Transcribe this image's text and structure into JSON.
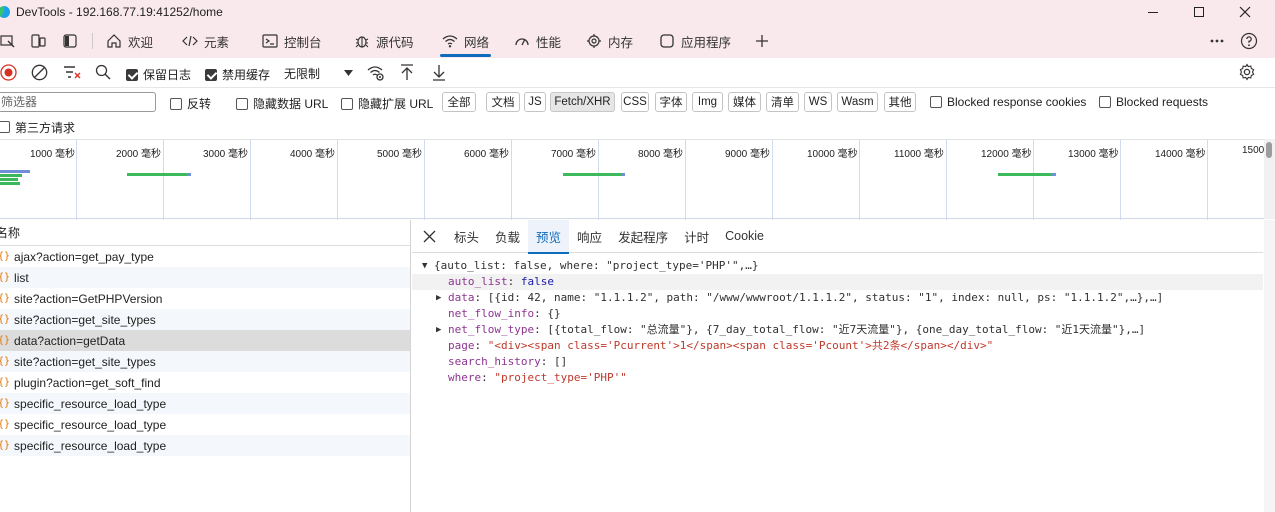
{
  "window": {
    "title": "DevTools - 192.168.77.19:41252/home",
    "controls": [
      "minimize",
      "maximize",
      "close"
    ]
  },
  "tabs": [
    {
      "label": "欢迎",
      "icon": "home-icon"
    },
    {
      "label": "元素",
      "icon": "code-icon"
    },
    {
      "label": "控制台",
      "icon": "console-icon"
    },
    {
      "label": "源代码",
      "icon": "bug-icon"
    },
    {
      "label": "网络",
      "icon": "wifi-icon",
      "active": true
    },
    {
      "label": "性能",
      "icon": "performance-icon"
    },
    {
      "label": "内存",
      "icon": "memory-icon"
    },
    {
      "label": "应用程序",
      "icon": "application-icon"
    }
  ],
  "toolbar": {
    "preserve_log": "保留日志",
    "disable_cache": "禁用缓存",
    "throttle": "无限制"
  },
  "filter": {
    "placeholder": "筛选器",
    "invert": "反转",
    "hide_data_url": "隐藏数据 URL",
    "hide_ext_url": "隐藏扩展 URL",
    "types": [
      "全部",
      "文档",
      "JS",
      "Fetch/XHR",
      "CSS",
      "字体",
      "Img",
      "媒体",
      "清单",
      "WS",
      "Wasm",
      "其他"
    ],
    "active_type": "Fetch/XHR",
    "blocked_cookies": "Blocked response cookies",
    "blocked_requests": "Blocked requests",
    "third_party": "第三方请求"
  },
  "overview": {
    "ticks": [
      "1000 毫秒",
      "2000 毫秒",
      "3000 毫秒",
      "4000 毫秒",
      "5000 毫秒",
      "6000 毫秒",
      "7000 毫秒",
      "8000 毫秒",
      "9000 毫秒",
      "10000 毫秒",
      "11000 毫秒",
      "12000 毫秒",
      "13000 毫秒",
      "14000 毫秒",
      "1500"
    ]
  },
  "requests": {
    "header": "名称",
    "items": [
      "ajax?action=get_pay_type",
      "list",
      "site?action=GetPHPVersion",
      "site?action=get_site_types",
      "data?action=getData",
      "site?action=get_site_types",
      "plugin?action=get_soft_find",
      "specific_resource_load_type",
      "specific_resource_load_type",
      "specific_resource_load_type"
    ],
    "selected_index": 4
  },
  "detail": {
    "tabs": [
      "标头",
      "负载",
      "预览",
      "响应",
      "发起程序",
      "计时",
      "Cookie"
    ],
    "active_tab": "预览",
    "preview": {
      "root": "{auto_list: false, where: \"project_type='PHP'\",…}",
      "auto_list_key": "auto_list",
      "auto_list_val": "false",
      "data_key": "data",
      "data_val": "[{id: 42, name: \"1.1.1.2\", path: \"/www/wwwroot/1.1.1.2\", status: \"1\", index: null, ps: \"1.1.1.2\",…},…]",
      "net_flow_info_key": "net_flow_info",
      "net_flow_info_val": "{}",
      "net_flow_type_key": "net_flow_type",
      "net_flow_type_val": "[{total_flow: \"总流量\"}, {7_day_total_flow: \"近7天流量\"}, {one_day_total_flow: \"近1天流量\"},…]",
      "page_key": "page",
      "page_val": "\"<div><span class='Pcurrent'>1</span><span class='Pcount'>共2条</span></div>\"",
      "search_history_key": "search_history",
      "search_history_val": "[]",
      "where_key": "where",
      "where_val": "\"project_type='PHP'\""
    }
  }
}
